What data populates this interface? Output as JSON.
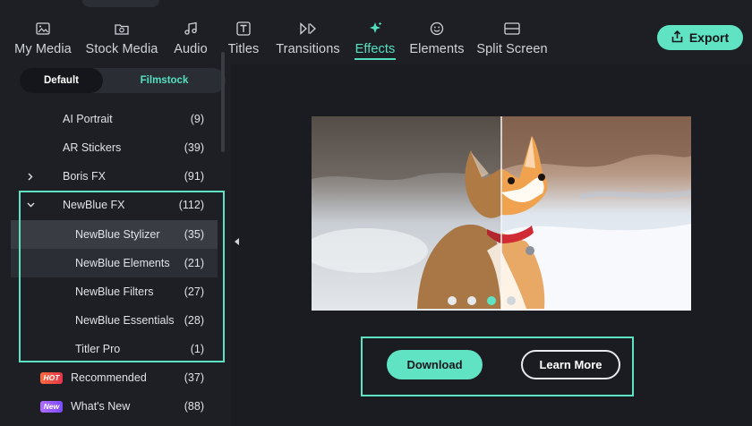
{
  "nav": {
    "items": [
      {
        "label": "My Media",
        "icon": "image-icon"
      },
      {
        "label": "Stock Media",
        "icon": "stock-media-icon"
      },
      {
        "label": "Audio",
        "icon": "music-note-icon"
      },
      {
        "label": "Titles",
        "icon": "text-t-icon"
      },
      {
        "label": "Transitions",
        "icon": "transition-icon"
      },
      {
        "label": "Effects",
        "icon": "sparkle-icon",
        "active": true
      },
      {
        "label": "Elements",
        "icon": "smiley-icon"
      },
      {
        "label": "Split Screen",
        "icon": "split-screen-icon"
      }
    ],
    "export_label": "Export"
  },
  "sidebar": {
    "tabs": {
      "default": "Default",
      "filmstock": "Filmstock"
    },
    "categories": [
      {
        "name": "AI Portrait",
        "count": "(9)"
      },
      {
        "name": "AR Stickers",
        "count": "(39)"
      },
      {
        "name": "Boris FX",
        "count": "(91)",
        "chevron": ">"
      },
      {
        "name": "NewBlue FX",
        "count": "(112)",
        "chevron": "v"
      },
      {
        "name": "NewBlue Stylizer",
        "count": "(35)"
      },
      {
        "name": "NewBlue Elements",
        "count": "(21)"
      },
      {
        "name": "NewBlue Filters",
        "count": "(27)"
      },
      {
        "name": "NewBlue Essentials",
        "count": "(28)"
      },
      {
        "name": "Titler Pro",
        "count": "(1)"
      },
      {
        "name": "Recommended",
        "count": "(37)",
        "badge": "HOT"
      },
      {
        "name": "What's New",
        "count": "(88)",
        "badge": "New"
      }
    ]
  },
  "preview": {
    "carousel_pages": 4,
    "active_page": 3
  },
  "actions": {
    "download_label": "Download",
    "learn_more_label": "Learn More"
  },
  "colors": {
    "accent": "#5fe3c3",
    "background": "#1b1c22",
    "sidebar": "#1e1f25",
    "selected_row": "#3a3c44"
  }
}
